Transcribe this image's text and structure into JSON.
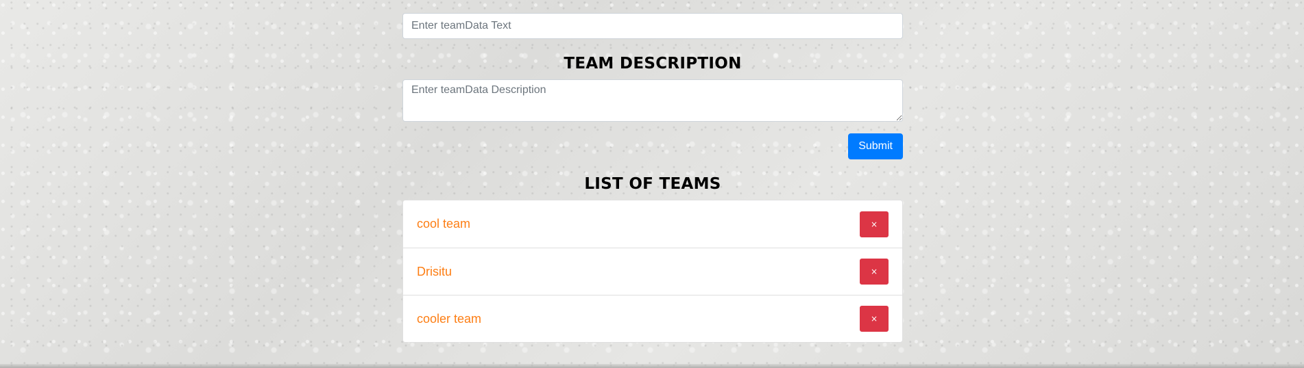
{
  "form": {
    "text_placeholder": "Enter teamData Text",
    "description_heading": "TEAM DESCRIPTION",
    "description_placeholder": "Enter teamData Description",
    "submit_label": "Submit"
  },
  "list": {
    "heading": "LIST OF TEAMS",
    "teams": [
      {
        "name": "cool team",
        "delete_icon": "×"
      },
      {
        "name": "Drisitu",
        "delete_icon": "×"
      },
      {
        "name": "cooler team",
        "delete_icon": "×"
      }
    ]
  },
  "colors": {
    "primary": "#007bff",
    "danger": "#dc3545",
    "team_name": "#fd7e14"
  },
  "icons": {
    "delete": "close-icon"
  }
}
